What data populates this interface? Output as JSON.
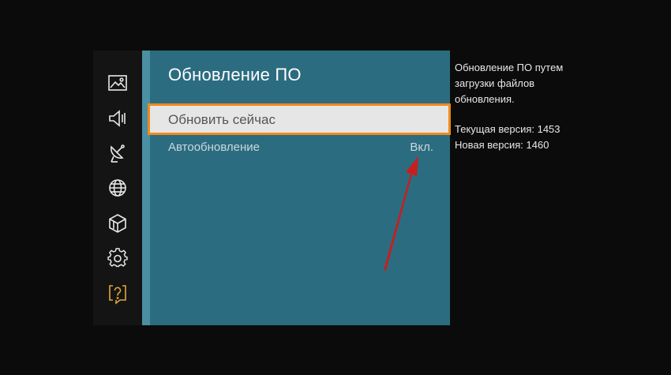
{
  "colors": {
    "panel": "#2c6c80",
    "panel_edge": "#4a8fa3",
    "selection_border": "#f08a1c",
    "selection_fill": "#e6e6e6",
    "help_icon": "#e0a83a",
    "arrow": "#c81e1e"
  },
  "sidebar": {
    "items": [
      {
        "icon": "picture-icon"
      },
      {
        "icon": "sound-icon"
      },
      {
        "icon": "broadcast-icon"
      },
      {
        "icon": "network-icon"
      },
      {
        "icon": "smart-hub-icon"
      },
      {
        "icon": "system-icon"
      },
      {
        "icon": "support-icon",
        "active": true
      }
    ]
  },
  "panel": {
    "title": "Обновление ПО",
    "items": [
      {
        "label": "Обновить сейчас",
        "selected": true
      },
      {
        "label": "Автообновление",
        "value": "Вкл."
      }
    ]
  },
  "info": {
    "description": [
      "Обновление ПО путем",
      "загрузки файлов",
      "обновления."
    ],
    "current_version": "Текущая версия: 1453",
    "new_version": "Новая версия: 1460"
  }
}
